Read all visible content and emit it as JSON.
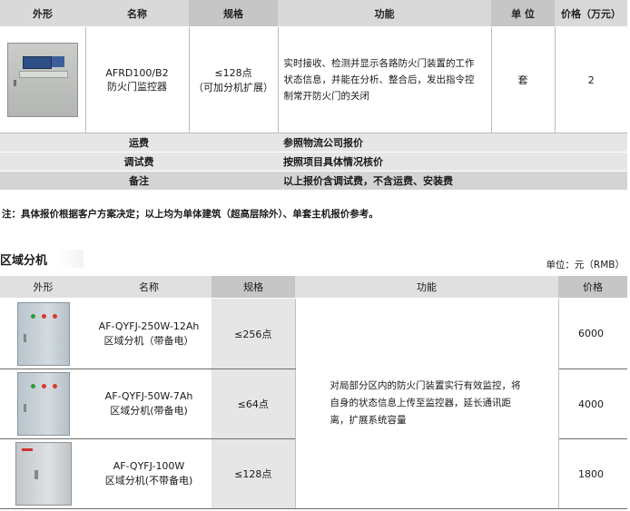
{
  "top_table": {
    "headers": [
      "外形",
      "名称",
      "规格",
      "功能",
      "单 位",
      "价格（万元）"
    ],
    "product": {
      "icon": "fire-door-monitor-image",
      "name_line1": "AFRD100/B2",
      "name_line2": "防火门监控器",
      "spec_line1": "≤128点",
      "spec_line2": "（可加分机扩展）",
      "function": "实时接收、检测并显示各路防火门装置的工作状态信息，并能在分析、整合后，发出指令控制常开防火门的关闭",
      "unit": "套",
      "price": "2"
    },
    "extras": [
      {
        "label": "运费",
        "value": "参照物流公司报价"
      },
      {
        "label": "调试费",
        "value": "按照项目具体情况核价"
      },
      {
        "label": "备注",
        "value": "以上报价含调试费，不含运费、安装费"
      }
    ]
  },
  "note": "注：具体报价根据客户方案决定；以上均为单体建筑（超高层除外）、单套主机报价参考。",
  "section": {
    "title": "区域分机",
    "unit": "单位：元（RMB）"
  },
  "sub_table": {
    "headers": [
      "外形",
      "名称",
      "规格",
      "功能",
      "价格"
    ],
    "function": "对局部分区内的防火门装置实行有效监控，将自身的状态信息上传至监控器，延长通讯距离，扩展系统容量",
    "rows": [
      {
        "icon": "cabinet-with-battery-image",
        "name_line1": "AF-QYFJ-250W-12Ah",
        "name_line2": "区域分机（带备电）",
        "spec": "≤256点",
        "price": "6000"
      },
      {
        "icon": "cabinet-with-battery-image",
        "name_line1": "AF-QYFJ-50W-7Ah",
        "name_line2": "区域分机(带备电)",
        "spec": "≤64点",
        "price": "4000"
      },
      {
        "icon": "cabinet-no-battery-image",
        "name_line1": "AF-QYFJ-100W",
        "name_line2": "区域分机(不带备电)",
        "spec": "≤128点",
        "price": "1800"
      }
    ]
  }
}
